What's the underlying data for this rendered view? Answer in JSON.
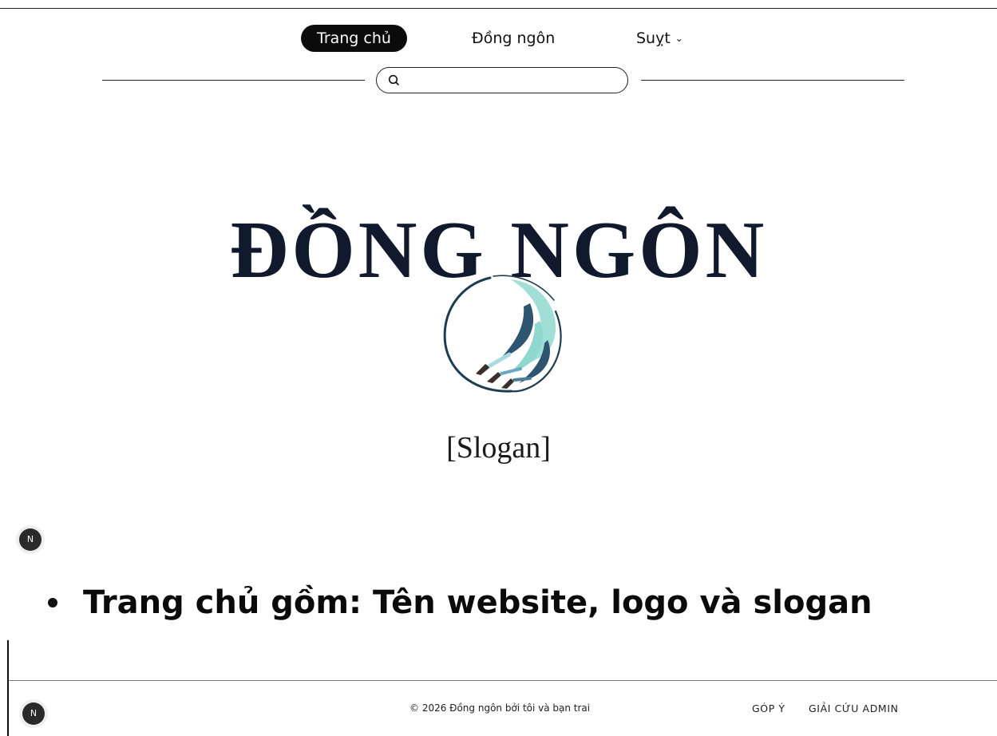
{
  "nav": {
    "items": [
      {
        "label": "Trang chủ"
      },
      {
        "label": "Đồng ngôn"
      },
      {
        "label": "Suỵt"
      }
    ]
  },
  "search": {
    "value": "",
    "placeholder": ""
  },
  "hero": {
    "title": "ĐỒNG NGÔN",
    "slogan": "[Slogan]"
  },
  "badge": {
    "letter": "N"
  },
  "content": {
    "bullet": "Trang chủ gồm: Tên website, logo và slogan"
  },
  "footer": {
    "copyright": "© 2026 Đồng ngôn bởi tôi và bạn trai",
    "links": [
      {
        "label": "GÓP Ý"
      },
      {
        "label": "GIẢI CỨU ADMIN"
      }
    ]
  },
  "icons": {
    "search": "search-icon",
    "chevron": "chevron-down-icon",
    "logo": "brush-circle-logo"
  },
  "colors": {
    "title": "#101a2c",
    "nav_active_bg": "#0b0b0b",
    "logo_teal": "#8fd8cf",
    "logo_navy": "#1f3d52"
  }
}
